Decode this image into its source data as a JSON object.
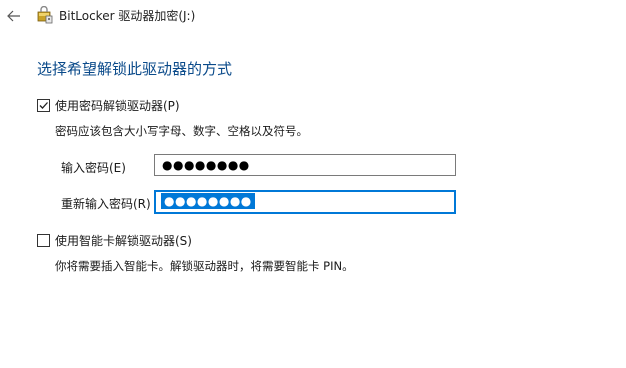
{
  "window": {
    "title": "BitLocker 驱动器加密(J:)",
    "back_icon": "back-arrow-icon",
    "app_icon": "bitlocker-drive-icon"
  },
  "main": {
    "heading": "选择希望解锁此驱动器的方式",
    "password_option": {
      "checked": true,
      "label": "使用密码解锁驱动器(P)",
      "description": "密码应该包含大小写字母、数字、空格以及符号。",
      "fields": [
        {
          "label": "输入密码(E)",
          "value": "●●●●●●●●",
          "focused": false
        },
        {
          "label": "重新输入密码(R)",
          "value": "●●●●●●●●",
          "focused": true
        }
      ]
    },
    "smartcard_option": {
      "checked": false,
      "label": "使用智能卡解锁驱动器(S)",
      "description": "你将需要插入智能卡。解锁驱动器时，将需要智能卡 PIN。"
    }
  },
  "colors": {
    "heading": "#0a4a8a",
    "focus_border": "#0078d7",
    "selection": "#0078d7"
  }
}
